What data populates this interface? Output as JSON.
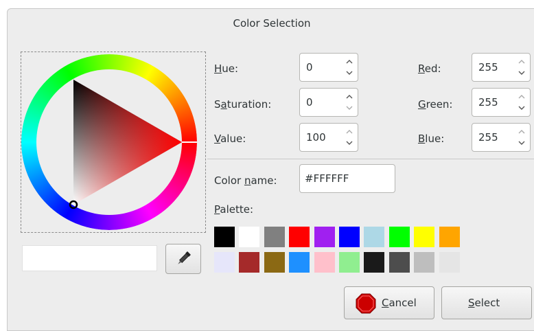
{
  "dialog": {
    "title": "Color Selection"
  },
  "hsv": {
    "hue": {
      "label_mnemonic": "H",
      "label_rest": "ue:",
      "value": "0"
    },
    "saturation": {
      "label_pre": "S",
      "label_mnemonic": "a",
      "label_rest": "turation:",
      "value": "0"
    },
    "value": {
      "label_mnemonic": "V",
      "label_rest": "alue:",
      "value": "100"
    }
  },
  "rgb": {
    "red": {
      "label_mnemonic": "R",
      "label_rest": "ed:",
      "value": "255"
    },
    "green": {
      "label_mnemonic": "G",
      "label_rest": "reen:",
      "value": "255"
    },
    "blue": {
      "label_mnemonic": "B",
      "label_rest": "lue:",
      "value": "255"
    }
  },
  "color_name": {
    "label_pre": "Color ",
    "label_mnemonic": "n",
    "label_rest": "ame:",
    "value": "#FFFFFF"
  },
  "palette": {
    "label_mnemonic": "P",
    "label_rest": "alette:",
    "row1": [
      "#000000",
      "#ffffff",
      "#808080",
      "#ff0000",
      "#a020f0",
      "#0000ff",
      "#add8e6",
      "#00ff00",
      "#ffff00",
      "#ffa500"
    ],
    "row2": [
      "#e6e6fa",
      "#a52a2a",
      "#8b6914",
      "#1e90ff",
      "#ffc0cb",
      "#90ee90",
      "#1a1a1a",
      "#4d4d4d",
      "#bebebe",
      "#e5e5e5"
    ]
  },
  "preview": {
    "current_color": "#ffffff"
  },
  "buttons": {
    "cancel": {
      "label_mnemonic": "C",
      "label_rest": "ancel",
      "icon": "stop-icon"
    },
    "select": {
      "label_mnemonic": "S",
      "label_rest": "elect"
    },
    "eyedropper": {
      "icon": "eyedropper-icon"
    }
  }
}
